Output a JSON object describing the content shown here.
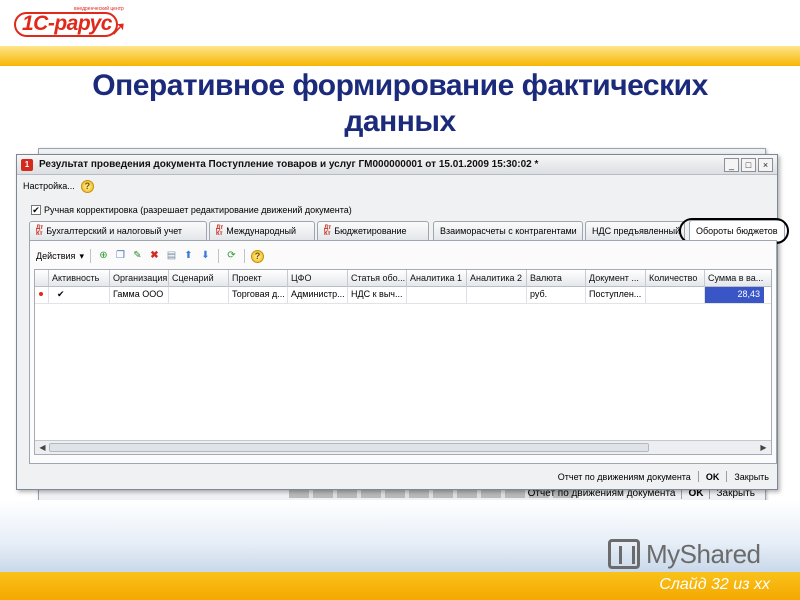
{
  "slide": {
    "logo_text": "1С-рарус",
    "logo_tagline": "внедренческий центр",
    "title": "Оперативное формирование фактических данных",
    "slide_number": "Слайд 32 из xx",
    "watermark": "MyShared"
  },
  "window": {
    "title": "Результат проведения документа Поступление товаров и услуг ГМ000000001 от 15.01.2009 15:30:02 *",
    "buttons": {
      "minimize": "_",
      "maximize": "□",
      "close": "×"
    },
    "menu": {
      "settings": "Настройка..."
    },
    "manual_adjust": {
      "checked": true,
      "label": "Ручная корректировка (разрешает редактирование движений документа)"
    },
    "tabs": [
      {
        "label": "Бухгалтерский и налоговый учет",
        "icon": "dt-kt-icon"
      },
      {
        "label": "Международный",
        "icon": "dt-kt-icon"
      },
      {
        "label": "Бюджетирование",
        "icon": "dt-kt-icon"
      },
      {
        "label": "Взаиморасчеты с контрагентами"
      },
      {
        "label": "НДС предъявленный"
      },
      {
        "label": "Обороты бюджетов",
        "active": true
      }
    ],
    "toolbar": {
      "actions_label": "Действия",
      "icons": [
        "add-icon",
        "copy-icon",
        "edit-icon",
        "delete-icon",
        "post-icon",
        "move-up-icon",
        "move-down-icon",
        "refresh-icon",
        "help-icon"
      ]
    },
    "grid": {
      "columns": [
        "Активность",
        "Организация",
        "Сценарий",
        "Проект",
        "ЦФО",
        "Статья обо...",
        "Аналитика 1",
        "Аналитика 2",
        "Валюта",
        "Документ ...",
        "Количество",
        "Сумма в ва..."
      ],
      "rows": [
        [
          "✔",
          "Гамма ООО",
          "",
          "Торговая д...",
          "Администр...",
          "НДС к выч...",
          "",
          "",
          "руб.",
          "Поступлен...",
          "",
          "28,43"
        ]
      ]
    },
    "footer": {
      "report": "Отчет по движениям документа",
      "ok": "OK",
      "close": "Закрыть"
    }
  },
  "colors": {
    "brand_red": "#e0281b",
    "title_blue": "#1b2a7a",
    "band_yellow": "#f7b500",
    "selection_blue": "#3a56c6"
  }
}
